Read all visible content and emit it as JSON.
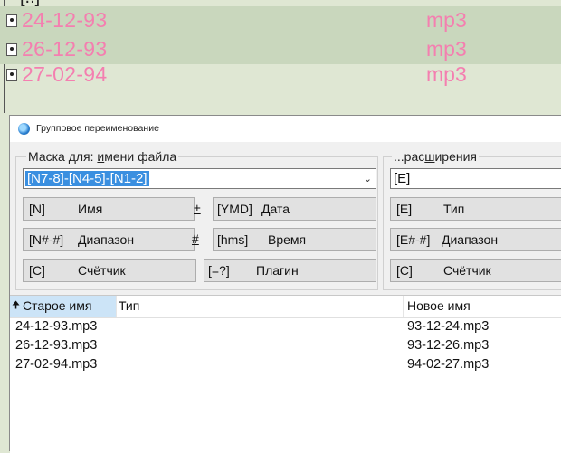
{
  "background_panel": {
    "parent_label": "[..]",
    "files": [
      {
        "name": "24-12-93",
        "ext": "mp3"
      },
      {
        "name": "26-12-93",
        "ext": "mp3"
      },
      {
        "name": "27-02-94",
        "ext": "mp3"
      }
    ]
  },
  "dialog": {
    "title": "Групповое переименование",
    "filename_group": {
      "label_prefix": "Маска для: ",
      "label_mnemonic": "и",
      "label_rest": "мени файла",
      "mask_value": "[N7-8]-[N4-5]-[N1-2]",
      "buttons": [
        {
          "code": "[N]",
          "text": "Имя"
        },
        {
          "code": "±",
          "text": ""
        },
        {
          "code": "[YMD]",
          "text": "Дата"
        },
        {
          "code": "[N#-#]",
          "text": "Диапазон"
        },
        {
          "code": "#",
          "text": ""
        },
        {
          "code": "[hms]",
          "text": "Время"
        },
        {
          "code": "[C]",
          "text": "Счётчик"
        },
        {
          "code": "[=?]",
          "text": "Плагин"
        }
      ]
    },
    "extension_group": {
      "label_prefix": "...рас",
      "label_mnemonic": "ш",
      "label_rest": "ирения",
      "mask_value": "[E]",
      "buttons": [
        {
          "code": "[E]",
          "text": "Тип"
        },
        {
          "code": "[E#-#]",
          "text": "Диапазон"
        },
        {
          "code": "[C]",
          "text": "Счётчик"
        }
      ]
    },
    "list": {
      "columns": {
        "old": "Старое имя",
        "type": "Тип",
        "new": "Новое имя"
      },
      "sort_arrow": "🠉",
      "rows": [
        {
          "old": "24-12-93.mp3",
          "new": "93-12-24.mp3"
        },
        {
          "old": "26-12-93.mp3",
          "new": "93-12-26.mp3"
        },
        {
          "old": "27-02-94.mp3",
          "new": "94-02-27.mp3"
        }
      ]
    }
  },
  "colors": {
    "file_text": "#f47fb0",
    "selection": "#3a8fe0",
    "panel_bg": "#dfe7d3",
    "panel_alt": "#c9d7bd"
  }
}
